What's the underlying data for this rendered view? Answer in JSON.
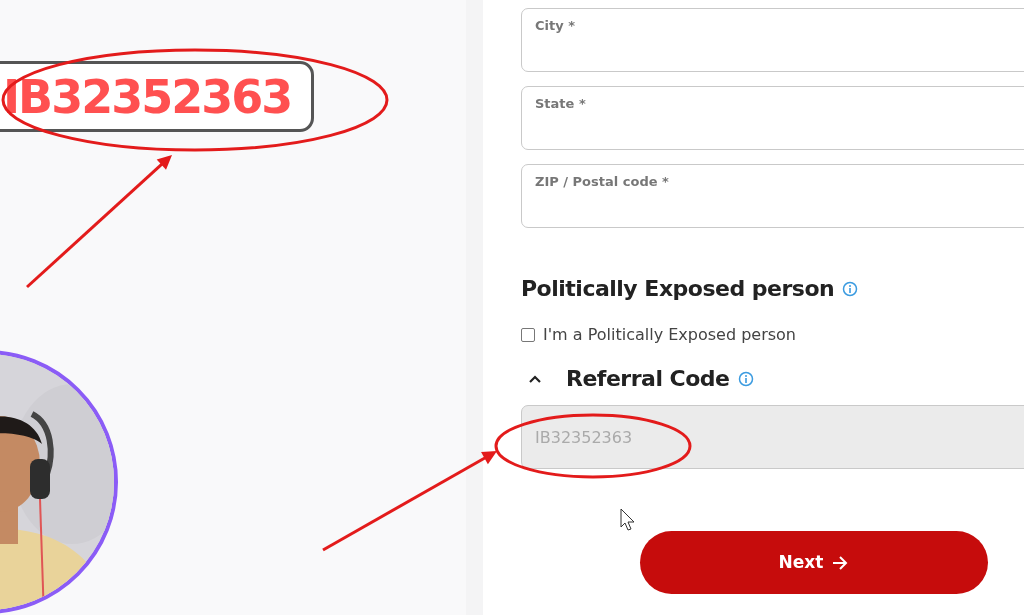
{
  "callout": {
    "text": "IB32352363"
  },
  "address_fields": [
    {
      "label": "City *"
    },
    {
      "label": "State *"
    },
    {
      "label": "ZIP / Postal code *"
    }
  ],
  "pep_section": {
    "title": "Politically Exposed person",
    "checkbox": {
      "label": "I'm a Politically Exposed person",
      "checked": false
    }
  },
  "referral_section": {
    "title": "Referral Code",
    "expanded": true,
    "field": {
      "value": "IB32352363",
      "disabled": true
    }
  },
  "next_button": {
    "label": "Next"
  }
}
